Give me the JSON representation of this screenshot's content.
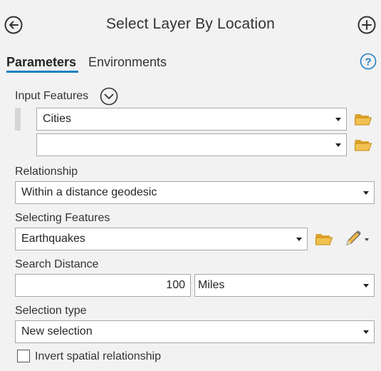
{
  "header": {
    "title": "Select Layer By Location",
    "back_icon": "back-arrow-circle-icon",
    "add_icon": "plus-circle-icon"
  },
  "tabs": [
    {
      "label": "Parameters",
      "active": true
    },
    {
      "label": "Environments",
      "active": false
    }
  ],
  "help_icon": "help-question-icon",
  "accent_color": "#1f7fc6",
  "input_features": {
    "label": "Input Features",
    "rows": [
      {
        "value": "Cities"
      },
      {
        "value": ""
      }
    ]
  },
  "relationship": {
    "label": "Relationship",
    "value": "Within a distance geodesic"
  },
  "selecting_features": {
    "label": "Selecting Features",
    "value": "Earthquakes"
  },
  "search_distance": {
    "label": "Search Distance",
    "value": "100",
    "unit": "Miles"
  },
  "selection_type": {
    "label": "Selection type",
    "value": "New selection"
  },
  "invert": {
    "label": "Invert spatial relationship",
    "checked": false
  }
}
